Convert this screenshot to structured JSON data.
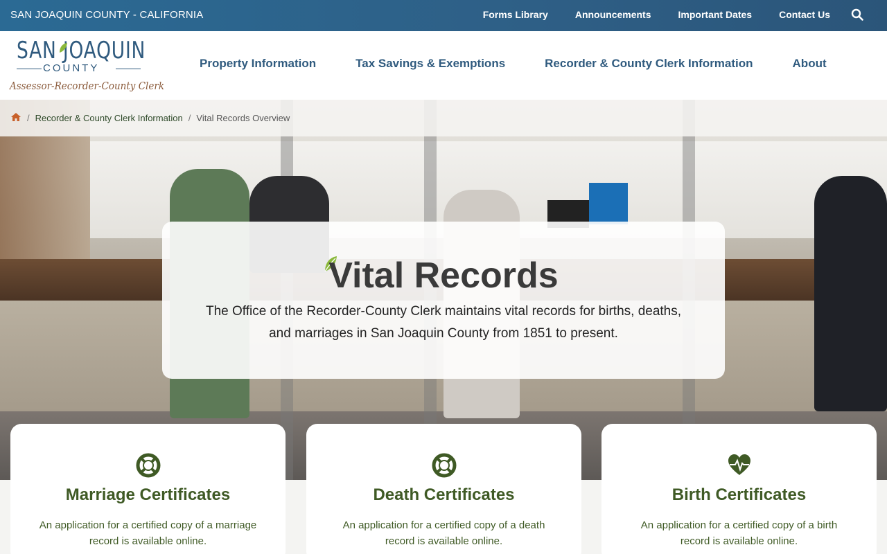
{
  "topbar": {
    "county": "SAN JOAQUIN COUNTY - CALIFORNIA",
    "links": [
      "Forms Library",
      "Announcements",
      "Important Dates",
      "Contact Us"
    ]
  },
  "logo": {
    "line1": "SAN JOAQUIN",
    "line2": "COUNTY",
    "line3": "Assessor-Recorder-County Clerk"
  },
  "nav": {
    "items": [
      "Property Information",
      "Tax Savings & Exemptions",
      "Recorder & County Clerk Information",
      "About"
    ]
  },
  "breadcrumb": {
    "parent": "Recorder & County Clerk Information",
    "current": "Vital Records Overview"
  },
  "hero": {
    "title": "Vital Records",
    "description": "The Office of the Recorder-County Clerk maintains vital records for births, deaths, and marriages in San Joaquin County from 1851 to present."
  },
  "cards": [
    {
      "icon": "lifebuoy-icon",
      "title": "Marriage Certificates",
      "text": "An application for a certified copy of a marriage record is available online."
    },
    {
      "icon": "lifebuoy-icon",
      "title": "Death Certificates",
      "text": "An application for a certified copy of a death record is available online."
    },
    {
      "icon": "heartbeat-icon",
      "title": "Birth Certificates",
      "text": "An application for a certified copy of a birth record is available online."
    }
  ],
  "colors": {
    "topbar": "#2e5f86",
    "nav_text": "#2f5a7e",
    "card_title": "#3f5a25",
    "leaf": "#8ab83a",
    "home_icon": "#c8602a"
  }
}
